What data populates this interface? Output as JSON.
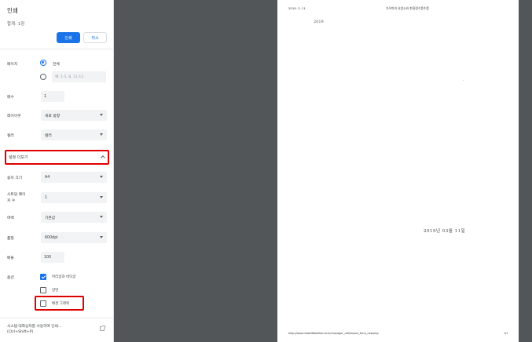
{
  "panel": {
    "title": "인쇄",
    "sheet_count": "합계: 1장",
    "print_button": "인쇄",
    "cancel_button": "취소",
    "pages": {
      "label": "페이지",
      "all": "전체",
      "range_placeholder": "예: 1-5, 8, 11-13"
    },
    "copies": {
      "label": "매수",
      "value": "1"
    },
    "layout": {
      "label": "레이아웃",
      "value": "세로 방향"
    },
    "color": {
      "label": "컬러",
      "value": "컬러"
    },
    "more_settings": {
      "label": "설정 더보기"
    },
    "paper_size": {
      "label": "용지 크기",
      "value": "A4"
    },
    "pages_per_sheet": {
      "label_line1": "시트당 페이",
      "label_line2": "지 수",
      "value": "1"
    },
    "margins": {
      "label": "여백",
      "value": "기본값"
    },
    "quality": {
      "label": "품질",
      "value": "600dpi"
    },
    "scale": {
      "label": "배율",
      "value": "100"
    },
    "options": {
      "label": "옵션",
      "headers_footers": "머리글과 바닥글",
      "duplex": "양면",
      "background_graphics": "배경 그래픽"
    },
    "system_dialog": {
      "line1": "시스템 대화상자를 사용하여 인쇄...",
      "line2": "(Ctrl+Shift+P)"
    }
  },
  "preview": {
    "header_date": "2019. 3. 11.",
    "header_title": "가우미의 사업소와 판권정수증수증",
    "year": "2019",
    "dot": "-",
    "center_date": "2019년 03월 11일",
    "footer_url": "http://www.makeitfabeltar.co.kr/manager_util/import_form_new.php",
    "page_number": "1/1"
  },
  "colors": {
    "accent": "#1a73e8",
    "highlight_red": "#e00000",
    "viewer_bg": "#525659"
  }
}
